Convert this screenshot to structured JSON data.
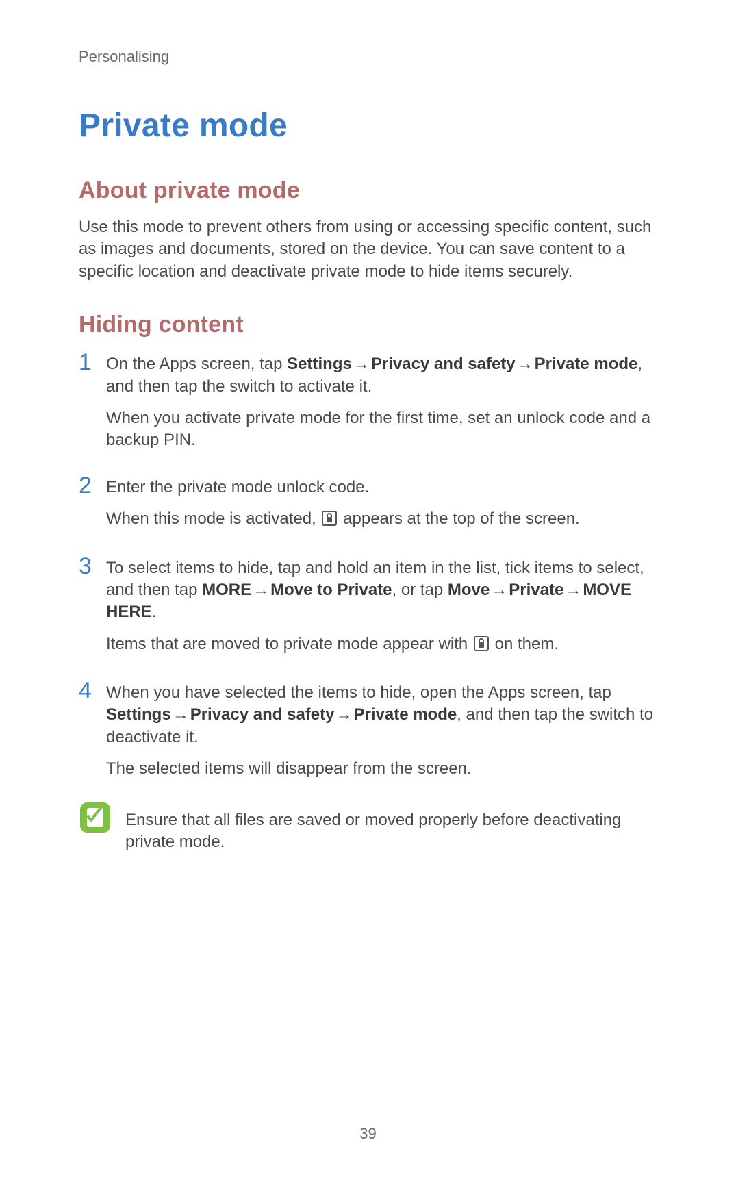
{
  "header": {
    "section": "Personalising"
  },
  "title": "Private mode",
  "about": {
    "heading": "About private mode",
    "body": "Use this mode to prevent others from using or accessing specific content, such as images and documents, stored on the device. You can save content to a specific location and deactivate private mode to hide items securely."
  },
  "hiding": {
    "heading": "Hiding content",
    "arrow": "→",
    "steps": [
      {
        "num": "1",
        "p1_a": "On the Apps screen, tap ",
        "p1_b1": "Settings",
        "p1_b2": "Privacy and safety",
        "p1_b3": "Private mode",
        "p1_c": ", and then tap the switch to activate it.",
        "p2": "When you activate private mode for the first time, set an unlock code and a backup PIN."
      },
      {
        "num": "2",
        "p1": "Enter the private mode unlock code.",
        "p2_a": "When this mode is activated, ",
        "p2_b": " appears at the top of the screen."
      },
      {
        "num": "3",
        "p1_a": "To select items to hide, tap and hold an item in the list, tick items to select, and then tap ",
        "p1_b1": "MORE",
        "p1_b2": "Move to Private",
        "p1_c": ", or tap ",
        "p1_b3": "Move",
        "p1_b4": "Private",
        "p1_b5": "MOVE HERE",
        "p1_d": ".",
        "p2_a": "Items that are moved to private mode appear with ",
        "p2_b": " on them."
      },
      {
        "num": "4",
        "p1_a": "When you have selected the items to hide, open the Apps screen, tap ",
        "p1_b1": "Settings",
        "p1_b2": "Privacy and safety",
        "p1_b3": "Private mode",
        "p1_c": ", and then tap the switch to deactivate it.",
        "p2": "The selected items will disappear from the screen."
      }
    ],
    "note": "Ensure that all files are saved or moved properly before deactivating private mode."
  },
  "page_number": "39"
}
